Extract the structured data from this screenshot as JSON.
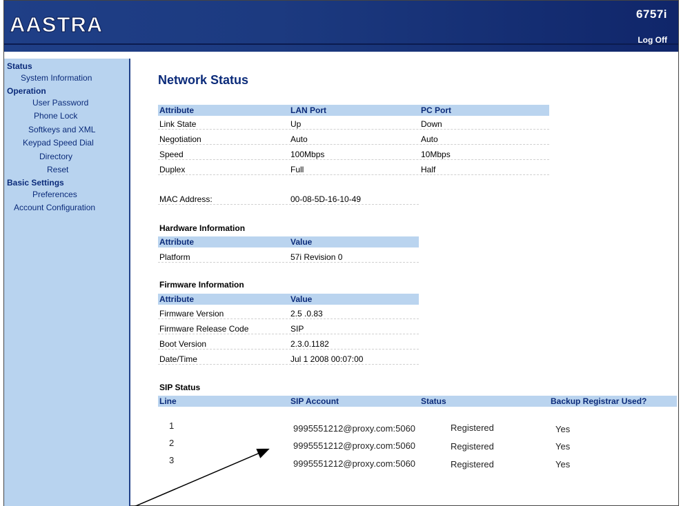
{
  "header": {
    "brand": "AASTRA",
    "model": "6757i",
    "logoff_label": "Log Off"
  },
  "sidebar": {
    "sections": [
      {
        "title": "Status",
        "items": [
          "System Information"
        ]
      },
      {
        "title": "Operation",
        "items": [
          "User Password",
          "Phone Lock",
          "Softkeys and XML",
          "Keypad Speed Dial",
          "Directory",
          "Reset"
        ]
      },
      {
        "title": "Basic Settings",
        "items": [
          "Preferences",
          "Account Configuration"
        ]
      }
    ]
  },
  "main": {
    "title": "Network Status",
    "network": {
      "headers": [
        "Attribute",
        "LAN Port",
        "PC Port"
      ],
      "rows": [
        [
          "Link State",
          "Up",
          "Down"
        ],
        [
          "Negotiation",
          "Auto",
          "Auto"
        ],
        [
          "Speed",
          "100Mbps",
          "10Mbps"
        ],
        [
          "Duplex",
          "Full",
          "Half"
        ]
      ],
      "mac_label": "MAC Address:",
      "mac_value": "00-08-5D-16-10-49"
    },
    "hardware": {
      "title": "Hardware Information",
      "headers": [
        "Attribute",
        "Value"
      ],
      "rows": [
        [
          "Platform",
          "57i Revision 0"
        ]
      ]
    },
    "firmware": {
      "title": "Firmware Information",
      "headers": [
        "Attribute",
        "Value"
      ],
      "rows": [
        [
          "Firmware Version",
          "2.5 .0.83"
        ],
        [
          "Firmware Release Code",
          "SIP"
        ],
        [
          "Boot Version",
          "2.3.0.1182"
        ],
        [
          "Date/Time",
          "Jul 1 2008 00:07:00"
        ]
      ]
    },
    "sip": {
      "title": "SIP Status",
      "headers": [
        "Line",
        "SIP Account",
        "Status",
        "Backup Registrar Used?"
      ],
      "rows": [
        [
          "1",
          "9995551212@proxy.com:5060",
          "Registered",
          "Yes"
        ],
        [
          "2",
          "9995551212@proxy.com:5060",
          "Registered",
          "Yes"
        ],
        [
          "3",
          "9995551212@proxy.com:5060",
          "Registered",
          "Yes"
        ]
      ]
    }
  },
  "colors": {
    "header_bg": "#1c3a80",
    "sidebar_bg": "#b8d3ef",
    "table_header_bg": "#bad4ef",
    "title_text": "#0b2b7a"
  }
}
